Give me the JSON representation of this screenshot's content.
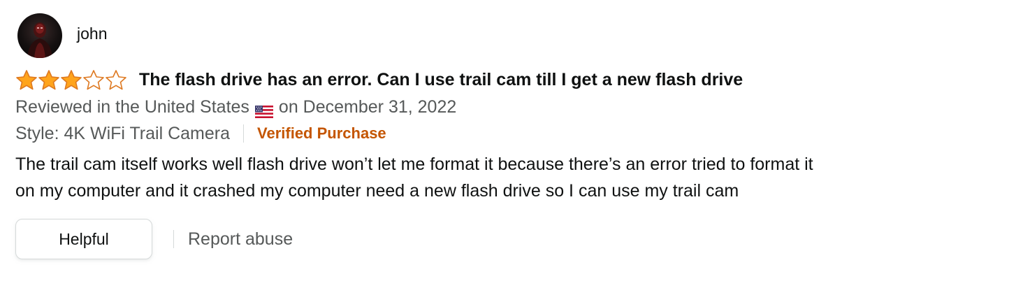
{
  "profile": {
    "name": "john"
  },
  "review": {
    "rating": 3,
    "max_rating": 5,
    "title": "The flash drive has an error. Can I use trail cam till I get a new flash drive",
    "reviewed_in": "Reviewed in the United States",
    "date": "on December 31, 2022",
    "style": "Style: 4K WiFi Trail Camera",
    "verified": "Verified Purchase",
    "body_line1": "The trail cam itself works well flash drive won’t let me format it because there’s an error tried to format it",
    "body_line2": "on my computer and it crashed my computer need a new flash drive so I can use my trail cam"
  },
  "actions": {
    "helpful_label": "Helpful",
    "report_label": "Report abuse"
  },
  "colors": {
    "star_fill": "#ffa41c",
    "star_outline": "#de7921",
    "verified": "#c45500",
    "meta_text": "#565959",
    "text": "#0f1111"
  },
  "icons": {
    "avatar": "profile-avatar",
    "flag": "us-flag-icon",
    "star_full": "star-filled-icon",
    "star_empty": "star-empty-icon"
  }
}
